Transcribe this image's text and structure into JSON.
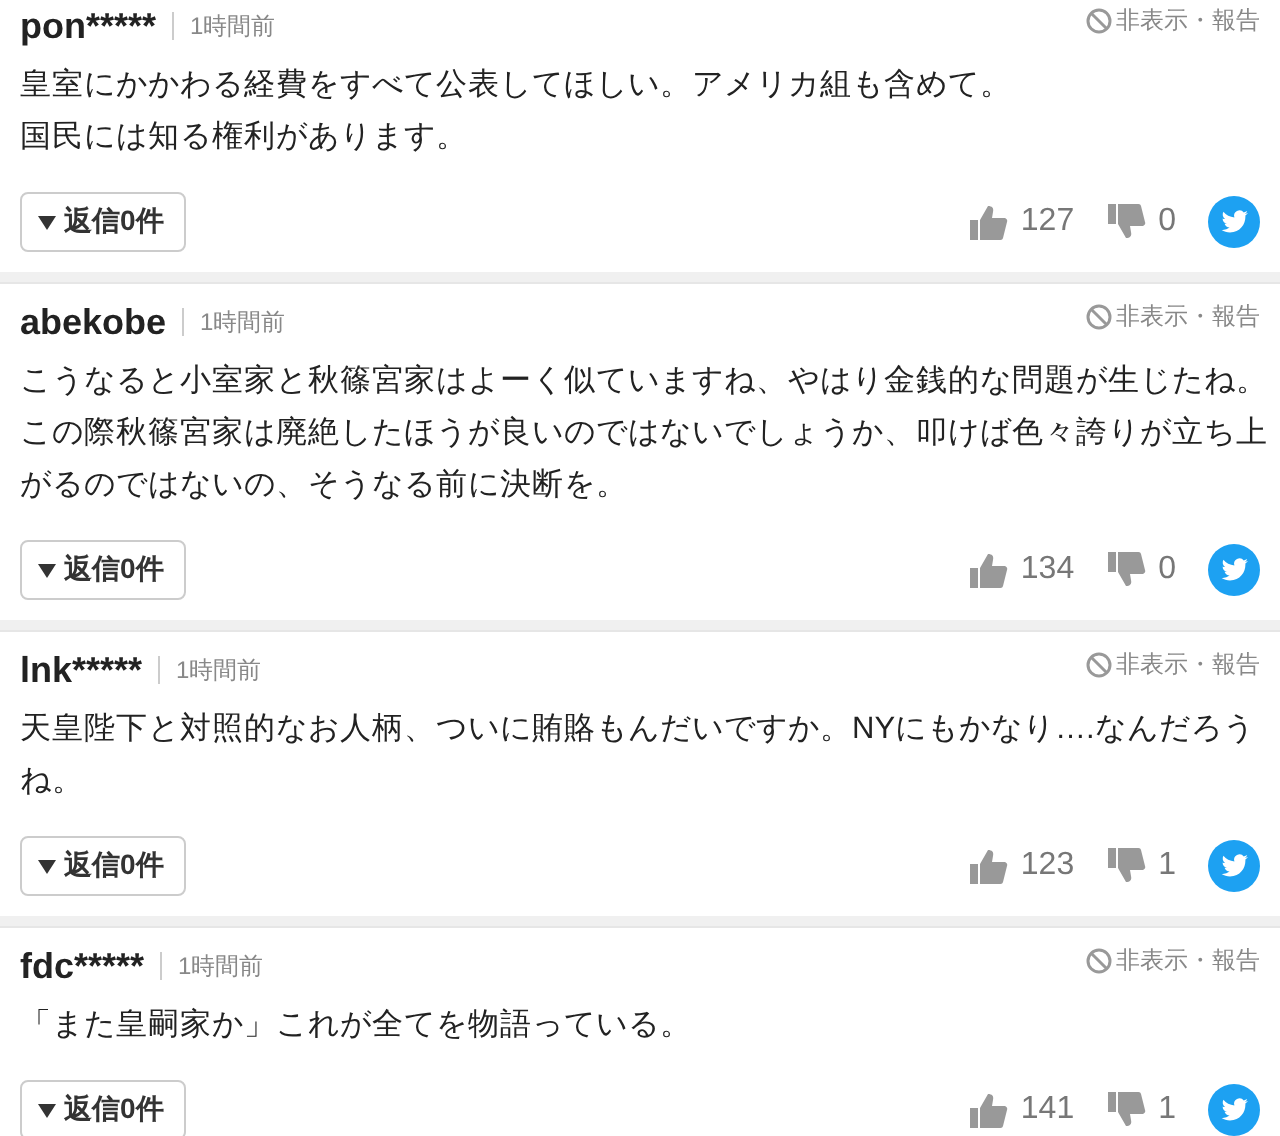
{
  "comments": [
    {
      "user": "pon*****",
      "time": "1時間前",
      "hide_report": "非表示・報告",
      "lines": [
        "皇室にかかわる経費をすべて公表してほしい。アメリカ組も含めて。",
        "国民には知る権利があります。"
      ],
      "replies": "返信0件",
      "likes": "127",
      "dislikes": "0"
    },
    {
      "user": "abekobe",
      "time": "1時間前",
      "hide_report": "非表示・報告",
      "lines": [
        "こうなると小室家と秋篠宮家はよーく似ていますね、やはり金銭的な問題が生じたね。",
        "この際秋篠宮家は廃絶したほうが良いのではないでしょうか、叩けば色々誇りが立ち上",
        "がるのではないの、そうなる前に決断を。"
      ],
      "replies": "返信0件",
      "likes": "134",
      "dislikes": "0"
    },
    {
      "user": "lnk*****",
      "time": "1時間前",
      "hide_report": "非表示・報告",
      "lines": [
        "天皇陛下と対照的なお人柄、ついに賄賂もんだいですか。NYにもかなり….なんだろう",
        "ね。"
      ],
      "replies": "返信0件",
      "likes": "123",
      "dislikes": "1"
    },
    {
      "user": "fdc*****",
      "time": "1時間前",
      "hide_report": "非表示・報告",
      "lines": [
        "「また皇嗣家か」これが全てを物語っている。"
      ],
      "replies": "返信0件",
      "likes": "141",
      "dislikes": "1"
    }
  ]
}
